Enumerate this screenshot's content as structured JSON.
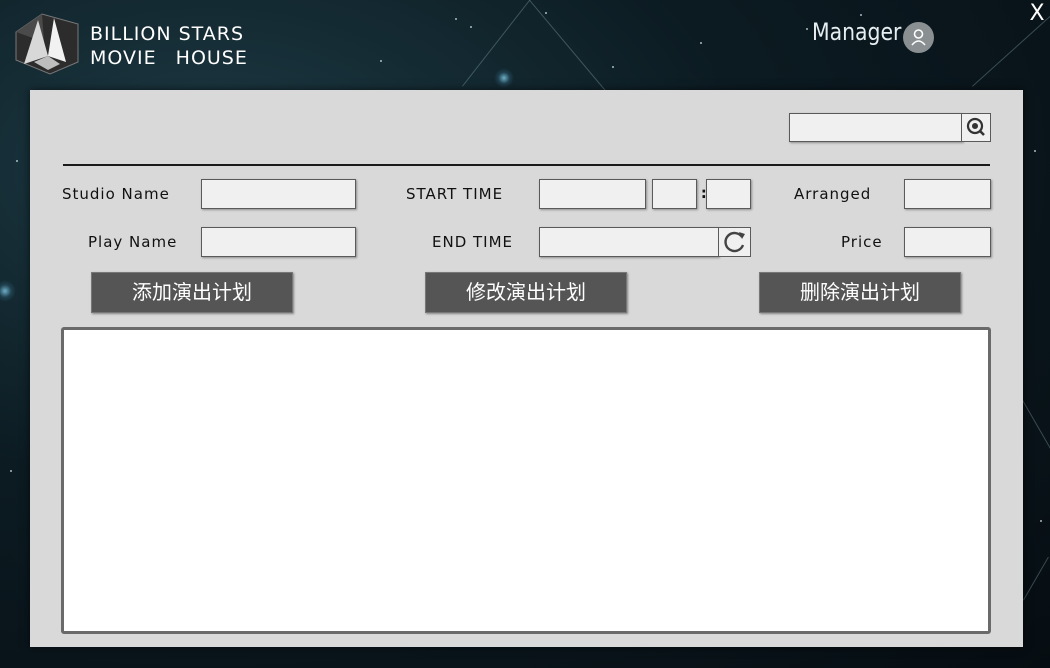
{
  "header": {
    "brand_line1": "BILLION STARS",
    "brand_line2": "MOVIE HOUSE",
    "user_label": "Manager",
    "close_label": "X"
  },
  "search": {
    "value": "",
    "placeholder": ""
  },
  "form": {
    "studio_name_label": "Studio Name",
    "play_name_label": "Play Name",
    "start_time_label": "START TIME",
    "end_time_label": "END TIME",
    "arranged_label": "Arranged",
    "price_label": "Price",
    "time_separator": ":",
    "studio_name_value": "",
    "play_name_value": "",
    "start_date_value": "",
    "start_hour_value": "",
    "start_minute_value": "",
    "end_time_value": "",
    "arranged_value": "",
    "price_value": ""
  },
  "actions": {
    "add_label": "添加演出计划",
    "modify_label": "修改演出计划",
    "delete_label": "删除演出计划"
  },
  "colors": {
    "panel_bg": "#d9d9d9",
    "button_bg": "#555555",
    "field_bg": "#f0f0f0",
    "background": "#0c1b22"
  },
  "icons": {
    "search": "search-icon",
    "refresh": "refresh-icon",
    "avatar": "user-avatar-icon",
    "logo": "star-logo-icon"
  }
}
